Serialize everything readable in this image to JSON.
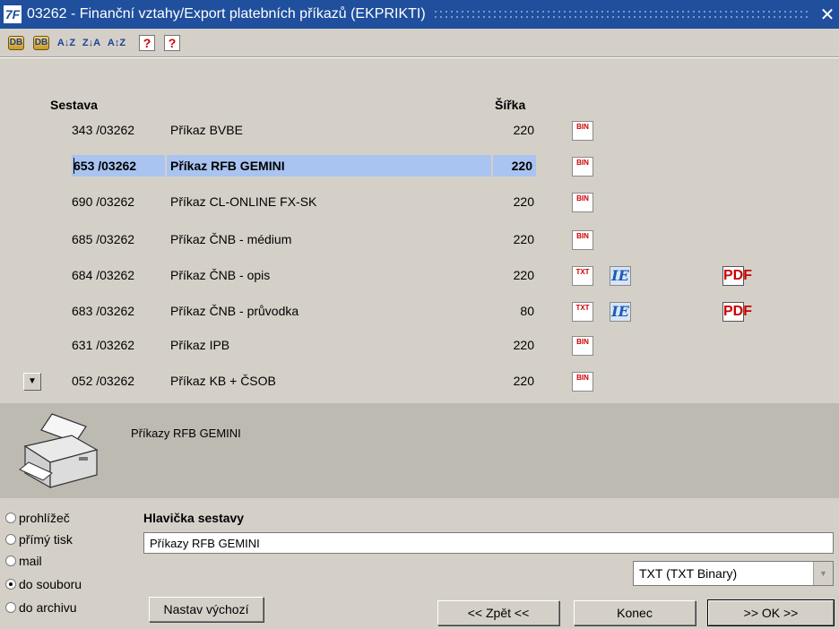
{
  "window": {
    "title": "03262 - Finanční vztahy/Export platebních příkazů (EKPRIKTI)",
    "app_icon": "7F",
    "close_label": "✕"
  },
  "toolbar": [
    {
      "name": "database-query-icon",
      "glyph": "DB"
    },
    {
      "name": "database-edit-icon",
      "glyph": "DB"
    },
    {
      "name": "sort-ascending-icon",
      "glyph": "A↓Z"
    },
    {
      "name": "sort-descending-icon",
      "glyph": "Z↓A"
    },
    {
      "name": "sort-custom-icon",
      "glyph": "A↕Z"
    },
    {
      "name": "help-icon",
      "glyph": "?"
    },
    {
      "name": "context-help-icon",
      "glyph": "?"
    }
  ],
  "list": {
    "col_sestava": "Sestava",
    "col_sirka": "Šířka",
    "rows": [
      {
        "id": "343 /03262",
        "name": "Příkaz BVBE",
        "width": "220",
        "formats": [
          "BIN"
        ],
        "selected": false
      },
      {
        "id": "653 /03262",
        "name": "Příkaz RFB GEMINI",
        "width": "220",
        "formats": [
          "BIN"
        ],
        "selected": true
      },
      {
        "id": "690 /03262",
        "name": "Příkaz CL-ONLINE FX-SK",
        "width": "220",
        "formats": [
          "BIN"
        ],
        "selected": false
      },
      {
        "id": "685 /03262",
        "name": "Příkaz ČNB - médium",
        "width": "220",
        "formats": [
          "BIN"
        ],
        "selected": false
      },
      {
        "id": "684 /03262",
        "name": "Příkaz ČNB - opis",
        "width": "220",
        "formats": [
          "TXT",
          "IE",
          "PDF"
        ],
        "selected": false
      },
      {
        "id": "683 /03262",
        "name": "Příkaz ČNB - průvodka",
        "width": "80",
        "formats": [
          "TXT",
          "IE",
          "PDF"
        ],
        "selected": false
      },
      {
        "id": "631 /03262",
        "name": "Příkaz IPB",
        "width": "220",
        "formats": [
          "BIN"
        ],
        "selected": false
      },
      {
        "id": "052 /03262",
        "name": "Příkaz KB + ČSOB",
        "width": "220",
        "formats": [
          "BIN"
        ],
        "selected": false
      }
    ]
  },
  "preview": {
    "description": "Příkazy RFB GEMINI"
  },
  "output": {
    "options": [
      {
        "label": "prohlížeč",
        "checked": false
      },
      {
        "label": "přímý tisk",
        "checked": false
      },
      {
        "label": "mail",
        "checked": false
      },
      {
        "label": "do souboru",
        "checked": true
      },
      {
        "label": "do archivu",
        "checked": false
      }
    ],
    "header_label": "Hlavička sestavy",
    "header_value": "Příkazy RFB GEMINI",
    "format_selected": "TXT (TXT Binary)",
    "btn_nastav": "Nastav výchozí",
    "btn_zpet": "<< Zpět <<",
    "btn_konec": "Konec",
    "btn_ok": ">> OK >>"
  }
}
